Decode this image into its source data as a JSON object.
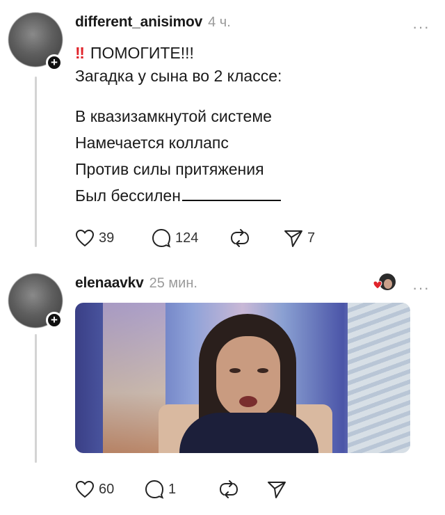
{
  "posts": [
    {
      "username": "different_anisimov",
      "time": "4 ч.",
      "more": "···",
      "urgent_mark": "‼",
      "title": "ПОМОГИТЕ!!!",
      "intro": "Загадка у сына во 2 классе:",
      "riddle_lines": [
        "В квазизамкнутой системе",
        "Намечается коллапс",
        "Против силы притяжения",
        "Был бессилен"
      ],
      "actions": {
        "likes": "39",
        "comments": "124",
        "shares": "7"
      }
    },
    {
      "username": "elenaavkv",
      "time": "25 мин.",
      "more": "···",
      "actions": {
        "likes": "60",
        "comments": "1"
      }
    }
  ],
  "icons": [
    "heart-icon",
    "comment-icon",
    "repost-icon",
    "send-icon",
    "follow-plus-icon",
    "more-icon"
  ],
  "colors": {
    "urgent": "#e0242b",
    "muted": "#9a9a9a",
    "text": "#1a1a1a",
    "thread_line": "#d4d4d4"
  }
}
